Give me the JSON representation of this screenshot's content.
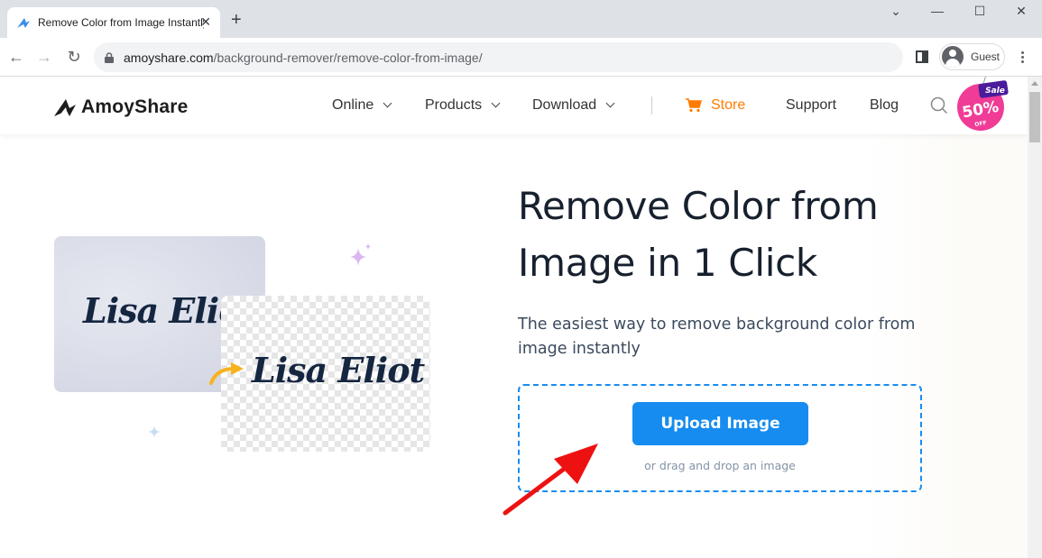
{
  "browser": {
    "tab": {
      "title": "Remove Color from Image Instantly",
      "favicon": "amoyshare-icon"
    },
    "new_tab_icon": "+",
    "window_controls": {
      "tab_search": "⌄",
      "minimize": "—",
      "maximize": "☐",
      "close": "✕"
    },
    "nav": {
      "back": "←",
      "forward": "→",
      "reload": "↻"
    },
    "url": {
      "domain": "amoyshare.com",
      "path": "/background-remover/remove-color-from-image/"
    },
    "profile_label": "Guest"
  },
  "site": {
    "brand": "AmoyShare",
    "nav": [
      {
        "label": "Online",
        "has_dropdown": true
      },
      {
        "label": "Products",
        "has_dropdown": true
      },
      {
        "label": "Download",
        "has_dropdown": true
      },
      {
        "label": "Store",
        "icon": "cart-icon"
      },
      {
        "label": "Support"
      },
      {
        "label": "Blog"
      }
    ],
    "sale_badge": {
      "tag": "Sale",
      "percent": "50%",
      "off": "OFF"
    },
    "colors": {
      "accent": "#168cf0",
      "store": "#ff7c00",
      "sale_pink": "#f03c96",
      "sale_purple": "#4a1c9c"
    }
  },
  "hero": {
    "title": "Remove Color from Image in 1 Click",
    "subtitle": "The easiest way to remove background color from image instantly",
    "upload_button": "Upload Image",
    "drop_hint": "or drag and drop an image",
    "illustration": {
      "before_text": "Lisa Eliot",
      "after_text": "Lisa Eliot"
    }
  }
}
